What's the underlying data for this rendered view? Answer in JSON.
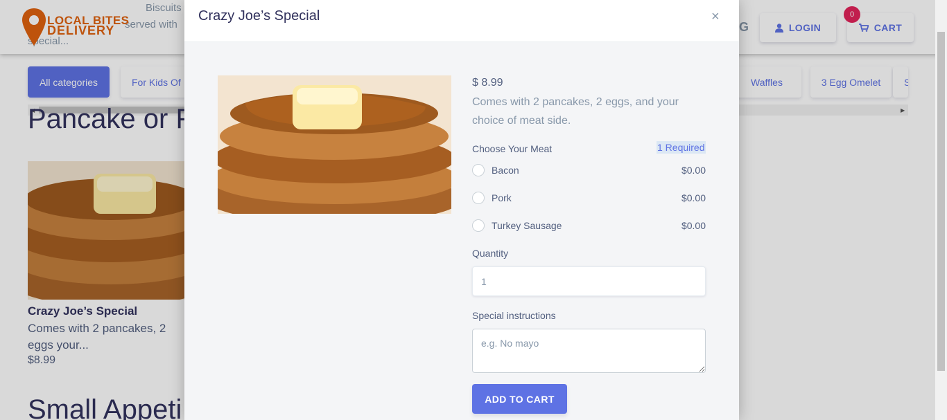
{
  "header": {
    "logo_line1": "LOCAL BITES",
    "logo_line2": "DELIVERY",
    "behind_text1": "Biscuits & Gravy",
    "behind_text2": "served with",
    "behind_text3": "special...",
    "partial_letter": "G",
    "login_label": "LOGIN",
    "cart_label": "CART",
    "cart_count": "0"
  },
  "categories": [
    {
      "label": "All categories",
      "active": true
    },
    {
      "label": "For Kids Of"
    },
    {
      "label": "Waffles"
    },
    {
      "label": "3 Egg Omelet"
    },
    {
      "label": "S"
    }
  ],
  "sections": {
    "first_title": "Pancake or F",
    "second_title": "Small Appeti"
  },
  "item": {
    "name": "Crazy Joe’s Special",
    "desc": "Comes with 2 pancakes, 2 eggs your...",
    "price": "$8.99"
  },
  "modal": {
    "title": "Crazy Joe’s Special",
    "close": "×",
    "price": "$ 8.99",
    "description": "Comes with 2 pancakes, 2 eggs, and your choice of meat side.",
    "meat_label": "Choose Your Meat",
    "required_label": "1 Required",
    "options": [
      {
        "name": "Bacon",
        "price": "$0.00"
      },
      {
        "name": "Pork",
        "price": "$0.00"
      },
      {
        "name": "Turkey Sausage",
        "price": "$0.00"
      }
    ],
    "quantity_label": "Quantity",
    "quantity_value": "1",
    "instructions_label": "Special instructions",
    "instructions_placeholder": "e.g. No mayo",
    "add_button": "ADD TO CART"
  },
  "colors": {
    "brand": "#e0620f",
    "accent": "#5e72e4",
    "badge": "#e3245b"
  },
  "icons": {
    "user": "user-icon",
    "cart": "cart-icon",
    "pin": "map-pin-icon"
  }
}
